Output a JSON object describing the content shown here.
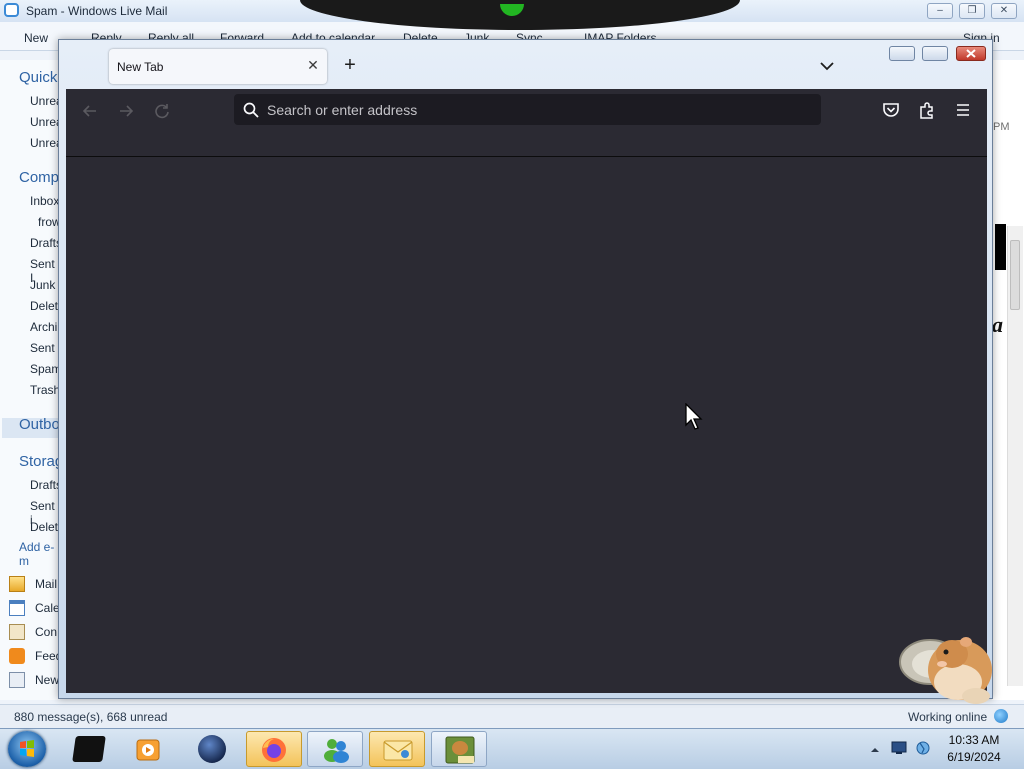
{
  "wlm": {
    "title": "Spam - Windows Live Mail",
    "ribbon": [
      {
        "label": "New"
      },
      {
        "label": "Reply"
      },
      {
        "label": "Reply all"
      },
      {
        "label": "Forward"
      },
      {
        "label": "Add to calendar"
      },
      {
        "label": "Delete"
      },
      {
        "label": "Junk"
      },
      {
        "label": "Sync"
      },
      {
        "label": "IMAP Folders"
      }
    ],
    "sign_in": "Sign in",
    "nav": {
      "quick": "Quick",
      "quick_items": [
        "Unrea",
        "Unrea",
        "Unrea"
      ],
      "comp": "Comp",
      "comp_items": [
        "Inbox",
        "frow",
        "Drafts",
        "Sent I",
        "Junk",
        "Delet",
        "Archi",
        "Sent",
        "Spam",
        "Trash"
      ],
      "outbox": "Outbo",
      "storage": "Storag",
      "storage_items": [
        "Drafts",
        "Sent i",
        "Delet"
      ],
      "add_account": "Add e-m"
    },
    "apps": [
      "Mail",
      "Cale",
      "Con",
      "Feed",
      "New"
    ],
    "time_fragment": "PM",
    "italic_fragment": "a",
    "status_messages": "880 message(s), 668 unread",
    "status_online": "Working online"
  },
  "firefox": {
    "tab_title": "New Tab",
    "url_placeholder": "Search or enter address"
  },
  "taskbar": {
    "time": "10:33 AM",
    "date": "6/19/2024"
  },
  "colors": {
    "ff_toolbar": "#2b2a33",
    "ff_urlbar": "#1c1b22",
    "wlm_accent": "#2f63a4"
  }
}
